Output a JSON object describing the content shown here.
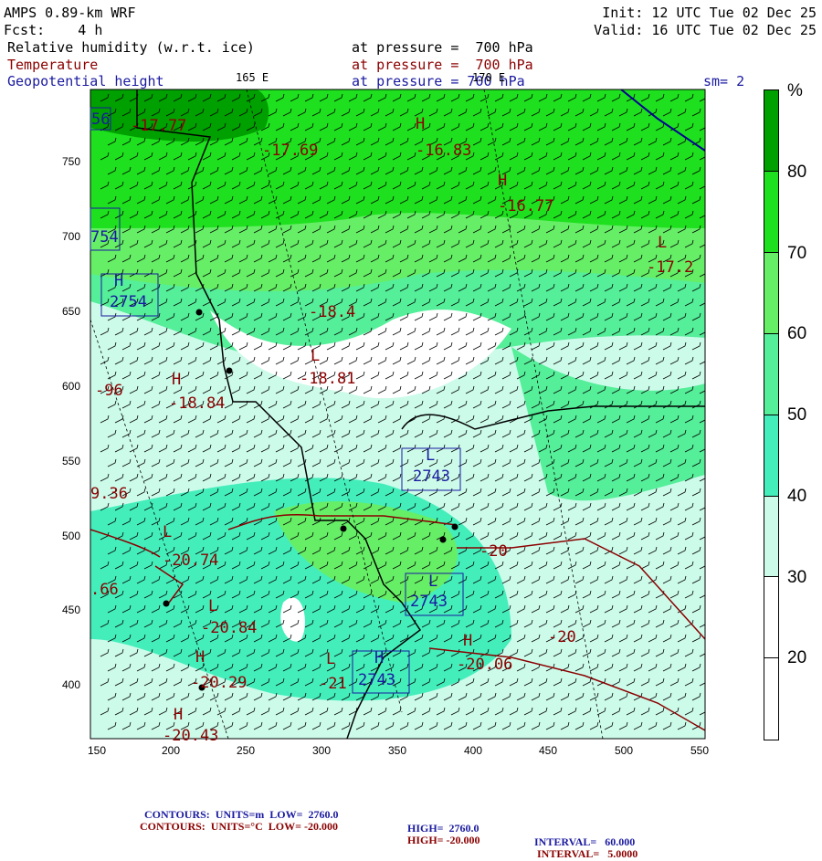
{
  "header": {
    "model": "AMPS 0.89-km WRF",
    "fcst": "Fcst:    4 h",
    "init": "Init: 12 UTC Tue 02 Dec 25",
    "valid": "Valid: 16 UTC Tue 02 Dec 25",
    "field1": "Relative humidity (w.r.t. ice)",
    "field1_level": "at pressure =  700 hPa",
    "field2": "Temperature",
    "field2_level": "at pressure =  700 hPa",
    "field3": "Geopotential height",
    "field3_level": "at pressure = 700 hPa",
    "sm": "sm= 2",
    "lon1": "165 E",
    "lon2": "170 E"
  },
  "colorbar": {
    "unit": "%",
    "labels": [
      "80",
      "70",
      "60",
      "50",
      "40",
      "30",
      "20"
    ],
    "colors": [
      "#00a000",
      "#1ee01e",
      "#66ee66",
      "#55ee99",
      "#44eebb",
      "#ccfbea",
      "#ffffff",
      "#ffffff"
    ]
  },
  "axes": {
    "x_ticks": [
      "150",
      "200",
      "250",
      "300",
      "350",
      "400",
      "450",
      "500",
      "550"
    ],
    "y_ticks": [
      "750",
      "700",
      "650",
      "600",
      "550",
      "500",
      "450",
      "400"
    ]
  },
  "map_labels": {
    "temp": [
      {
        "t": "-17.77"
      },
      {
        "t": "-17.69"
      },
      {
        "t": "H"
      },
      {
        "t": "-16.83"
      },
      {
        "t": "H"
      },
      {
        "t": "-16.77"
      },
      {
        "t": "L"
      },
      {
        "t": "-17.2"
      },
      {
        "t": "-18.4"
      },
      {
        "t": "L"
      },
      {
        "t": "-18.81"
      },
      {
        "t": "H"
      },
      {
        "t": "-18.84"
      },
      {
        "t": "-96"
      },
      {
        "t": "9.36"
      },
      {
        "t": "L"
      },
      {
        "t": "-20.74"
      },
      {
        "t": ".66"
      },
      {
        "t": "L"
      },
      {
        "t": "-20.84"
      },
      {
        "t": "H"
      },
      {
        "t": "-20.29"
      },
      {
        "t": "H"
      },
      {
        "t": "-20.43"
      },
      {
        "t": "L"
      },
      {
        "t": "-21"
      },
      {
        "t": "-20"
      },
      {
        "t": "-20"
      },
      {
        "t": "H"
      },
      {
        "t": "-20.06"
      }
    ],
    "height": [
      {
        "t": "56"
      },
      {
        "t": "754"
      },
      {
        "t": "H"
      },
      {
        "t": "2754"
      },
      {
        "t": "L"
      },
      {
        "t": "2743"
      },
      {
        "t": "L"
      },
      {
        "t": "2743"
      },
      {
        "t": "H"
      },
      {
        "t": "2743"
      }
    ]
  },
  "footer": {
    "line1": {
      "label": "CONTOURS:  UNITS=m  LOW=  2760.0",
      "high": "HIGH=  2760.0",
      "interval": "INTERVAL=   60.000"
    },
    "line2": {
      "label": "CONTOURS:  UNITS=°C  LOW= -20.000",
      "high": "HIGH= -20.000",
      "interval": "INTERVAL=   5.0000"
    }
  }
}
